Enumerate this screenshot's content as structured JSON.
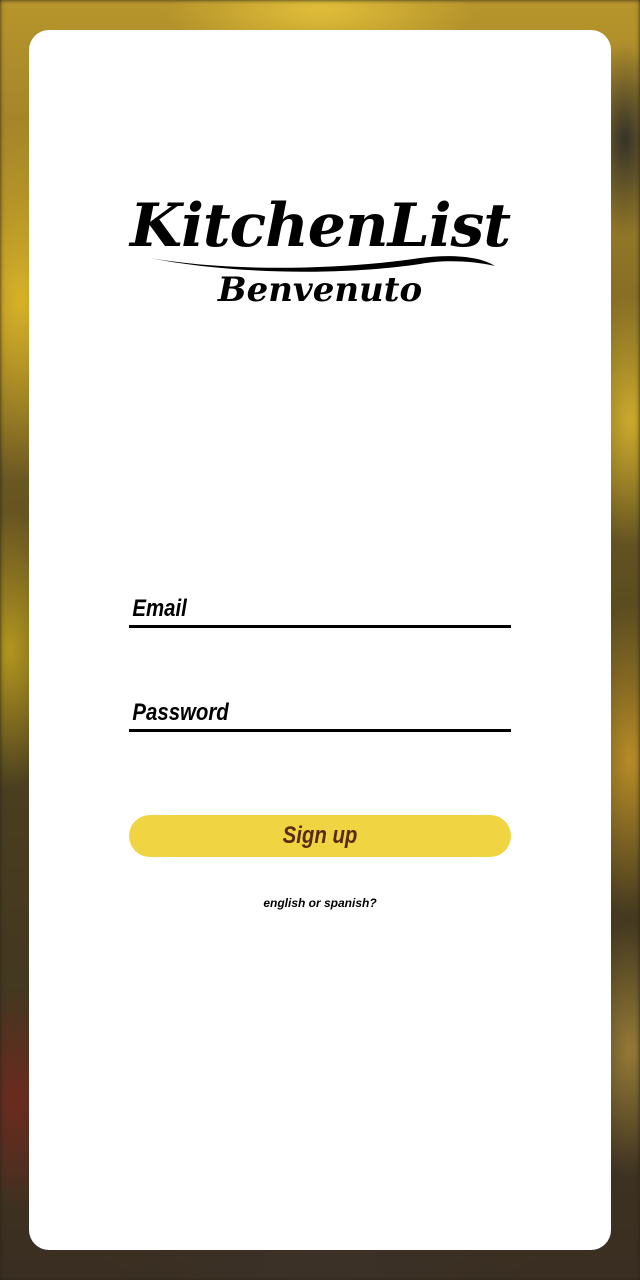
{
  "logo": {
    "title": "KitchenList",
    "subtitle": "Benvenuto"
  },
  "form": {
    "email_placeholder": "Email",
    "password_placeholder": "Password",
    "signup_label": "Sign up",
    "language_link": "english or spanish?"
  },
  "colors": {
    "button_bg": "#f0d442",
    "button_text": "#5a2a10",
    "card_bg": "#ffffff"
  }
}
